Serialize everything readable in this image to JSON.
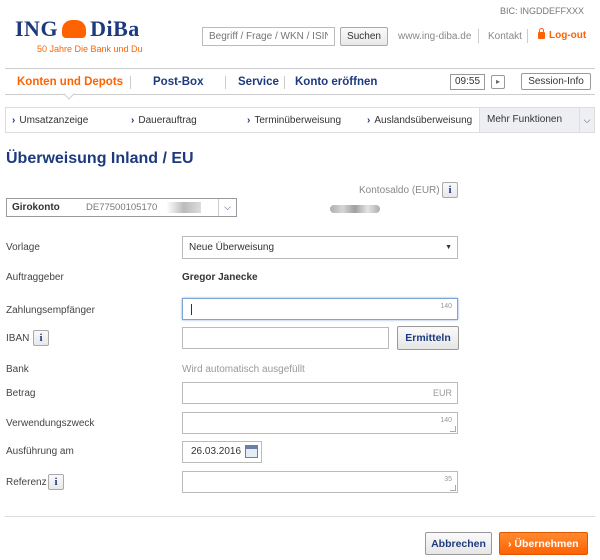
{
  "header": {
    "logo_text_left": "ING",
    "logo_text_right": "DiBa",
    "logo_tagline": "50 Jahre Die Bank und Du",
    "bic": "BIC: INGDDEFFXXX",
    "search_placeholder": "Begriff / Frage / WKN / ISIN",
    "search_button": "Suchen",
    "links": [
      "www.ing-diba.de",
      "Kontakt"
    ],
    "logout": "Log-out"
  },
  "main_nav": {
    "items": [
      "Konten und Depots",
      "Post-Box",
      "Service",
      "Konto eröffnen"
    ],
    "active_index": 0,
    "timer": "09:55",
    "session_info": "Session-Info"
  },
  "sub_nav": {
    "items": [
      "Umsatzanzeige",
      "Dauerauftrag",
      "Terminüberweisung",
      "Auslandsüberweisung"
    ],
    "more": "Mehr Funktionen"
  },
  "page": {
    "title": "Überweisung Inland / EU",
    "saldo_label": "Kontosaldo (EUR)",
    "account_name": "Girokonto",
    "account_iban": "DE77500105170"
  },
  "form": {
    "vorlage_label": "Vorlage",
    "vorlage_value": "Neue Überweisung",
    "auftraggeber_label": "Auftraggeber",
    "auftraggeber_value": "Gregor Janecke",
    "empfaenger_label": "Zahlungsempfänger",
    "empfaenger_counter": "140",
    "iban_label": "IBAN",
    "ermitteln_button": "Ermitteln",
    "bank_label": "Bank",
    "bank_value": "Wird automatisch ausgefüllt",
    "betrag_label": "Betrag",
    "betrag_currency": "EUR",
    "zweck_label": "Verwendungszweck",
    "zweck_counter": "140",
    "ausfuehrung_label": "Ausführung am",
    "ausfuehrung_value": "26.03.2016",
    "referenz_label": "Referenz",
    "referenz_counter": "35"
  },
  "actions": {
    "cancel": "Abbrechen",
    "submit": "Übernehmen"
  },
  "colors": {
    "brand_blue": "#1d3a7e",
    "brand_orange": "#ff6200"
  }
}
